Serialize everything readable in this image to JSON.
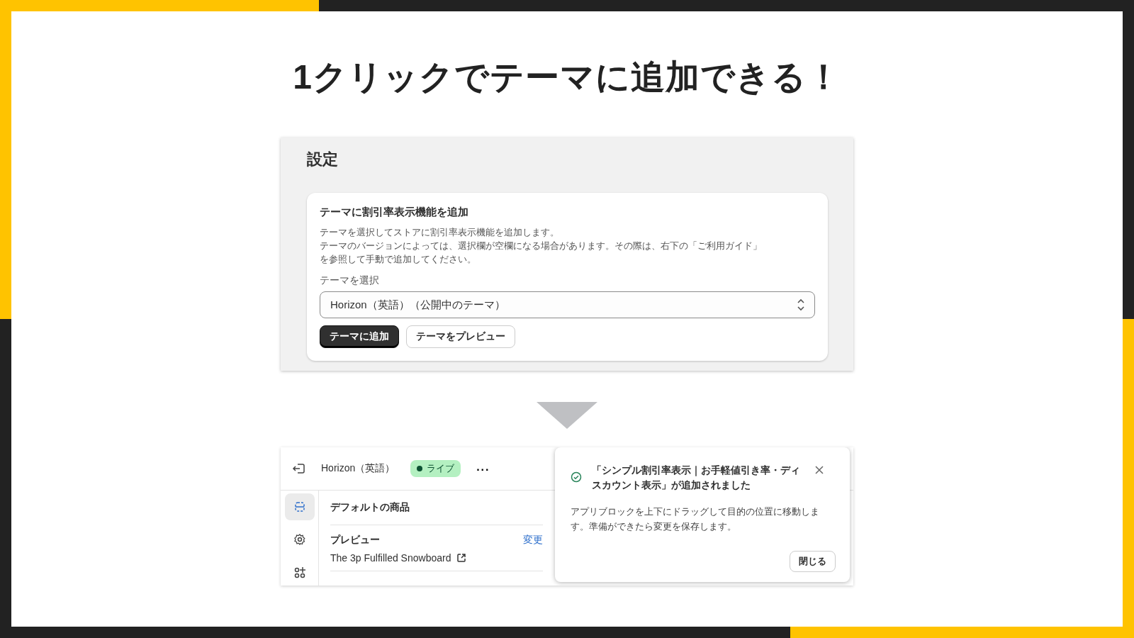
{
  "headline": "1クリックでテーマに追加できる！",
  "settings_panel": {
    "heading": "設定",
    "card": {
      "title": "テーマに割引率表示機能を追加",
      "description_lines": [
        "テーマを選択してストアに割引率表示機能を追加します。",
        "テーマのバージョンによっては、選択欄が空欄になる場合があります。その際は、右下の「ご利用ガイド」",
        "を参照して手動で追加してください。"
      ],
      "select_label": "テーマを選択",
      "select_value": "Horizon（英語）（公開中のテーマ）",
      "buttons": [
        {
          "label": "テーマに追加",
          "kind": "primary"
        },
        {
          "label": "テーマをプレビュー",
          "kind": "secondary"
        }
      ]
    }
  },
  "editor": {
    "theme_name": "Horizon（英語）",
    "status_badge": "ライブ",
    "more": "···",
    "sidebar_items": [
      {
        "kind": "sections",
        "selected": true
      },
      {
        "kind": "settings",
        "selected": false
      },
      {
        "kind": "apps",
        "selected": false
      }
    ],
    "section_title": "デフォルトの商品",
    "preview_label": "プレビュー",
    "change_link": "変更",
    "preview_value": "The 3p Fulfilled Snowboard"
  },
  "toast": {
    "title": "「シンプル割引率表示｜お手軽値引き率・ディスカウント表示」が追加されました",
    "message": "アプリブロックを上下にドラッグして目的の位置に移動します。準備ができたら変更を保存します。",
    "close_button": "閉じる"
  }
}
